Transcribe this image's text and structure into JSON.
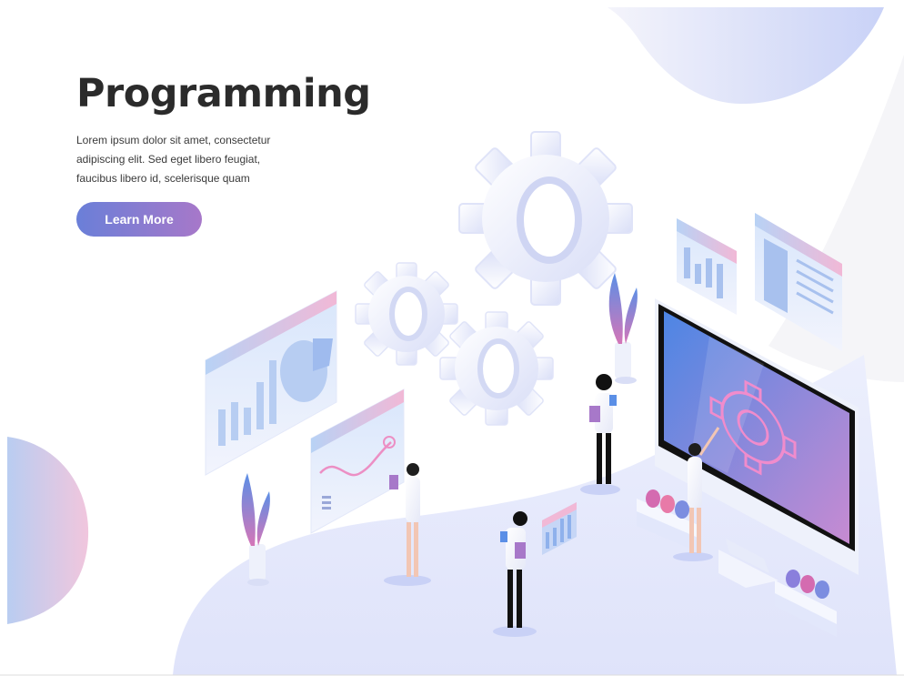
{
  "hero": {
    "title": "Programming",
    "description": "Lorem ipsum dolor sit amet, consectetur adipiscing elit. Sed eget libero feugiat, faucibus libero id, scelerisque quam",
    "cta_label": "Learn More"
  },
  "colors": {
    "title": "#2b2b2b",
    "button_start": "#6a7fd8",
    "button_end": "#a778c9",
    "floor": "#e3e6fb",
    "accent_pink": "#ec8fc4",
    "accent_blue": "#5b8fe6"
  },
  "illustration": {
    "icons": [
      "gear-icon",
      "bar-chart-icon",
      "pie-chart-icon",
      "line-chart-icon",
      "monitor-icon",
      "plant-icon",
      "person-icon",
      "document-icon"
    ]
  }
}
